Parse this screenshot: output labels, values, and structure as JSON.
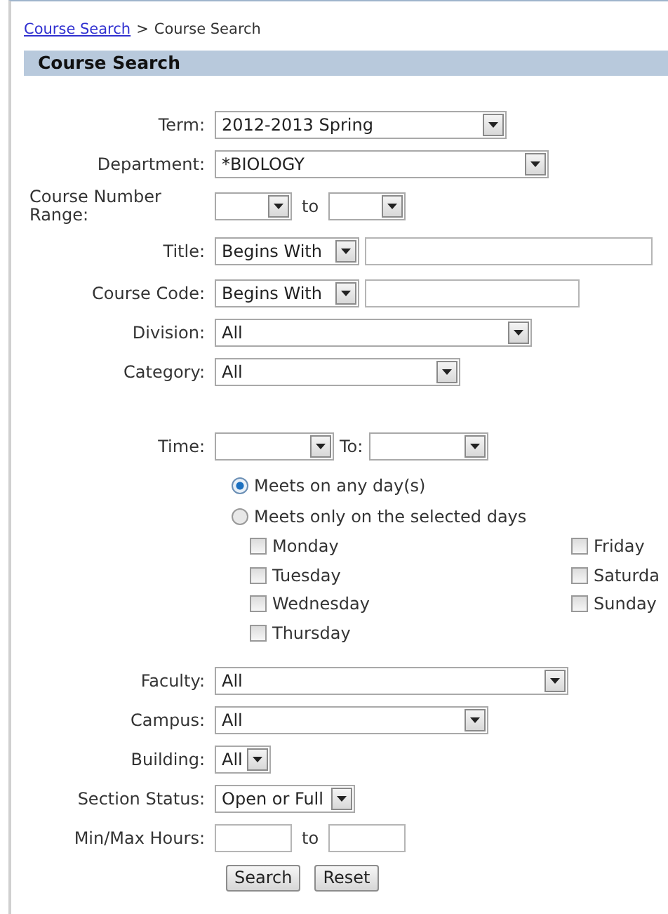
{
  "breadcrumb": {
    "link": "Course Search",
    "separator": ">",
    "current": "Course Search"
  },
  "panel": {
    "title": "Course Search"
  },
  "fields": [
    {
      "kind": "select",
      "label": "Term:",
      "value": "2012-2013 Spring"
    },
    {
      "kind": "select",
      "label": "Department:",
      "value": "*BIOLOGY"
    },
    {
      "kind": "select_range",
      "label": "Course Number Range:",
      "joiner": "to"
    },
    {
      "kind": "match",
      "label": "Title:",
      "value": "Begins With"
    },
    {
      "kind": "match",
      "label": "Course Code:",
      "value": "Begins With"
    },
    {
      "kind": "select",
      "label": "Division:",
      "value": "All"
    },
    {
      "kind": "select",
      "label": "Category:",
      "value": "All"
    },
    {
      "kind": "time_range",
      "label": "Time:",
      "joiner": "To:"
    },
    {
      "kind": "days",
      "options": [
        {
          "label": "Meets on any day(s)",
          "selected": true
        },
        {
          "label": "Meets only on the selected days",
          "selected": false
        }
      ],
      "days": [
        {
          "label": "Monday",
          "checked": false
        },
        {
          "label": "Tuesday",
          "checked": false
        },
        {
          "label": "Wednesday",
          "checked": false
        },
        {
          "label": "Thursday",
          "checked": false
        },
        {
          "label": "Friday",
          "checked": false
        },
        {
          "label": "Saturda",
          "checked": false
        },
        {
          "label": "Sunday",
          "checked": false
        }
      ]
    },
    {
      "kind": "select",
      "label": "Faculty:",
      "value": "All"
    },
    {
      "kind": "select",
      "label": "Campus:",
      "value": "All"
    },
    {
      "kind": "select",
      "label": "Building:",
      "value": "All"
    },
    {
      "kind": "select",
      "label": "Section Status:",
      "value": "Open or Full"
    },
    {
      "kind": "text_range",
      "label": "Min/Max Hours:",
      "joiner": "to"
    }
  ],
  "buttons": [
    "Search",
    "Reset"
  ]
}
